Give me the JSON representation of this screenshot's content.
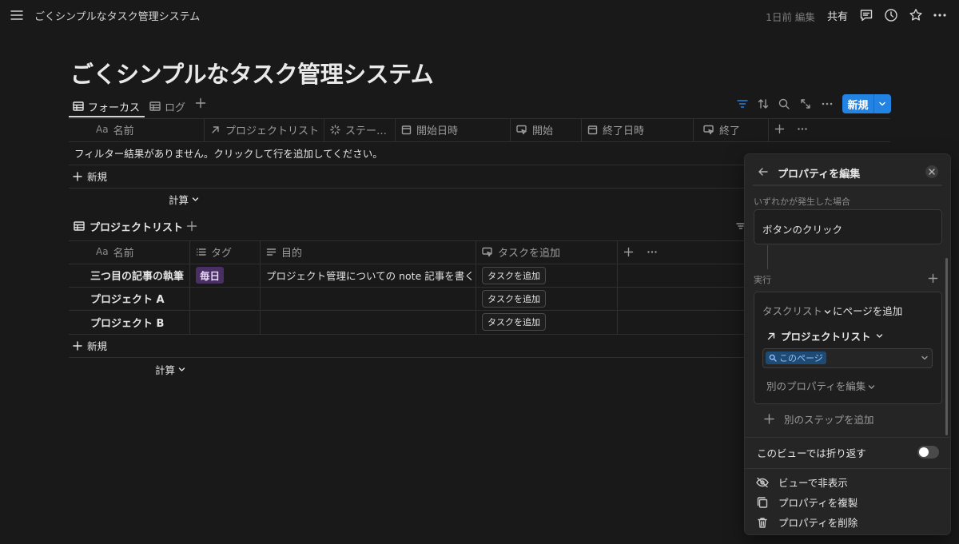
{
  "topbar": {
    "breadcrumb": "ごくシンプルなタスク管理システム",
    "edited": "1日前 編集",
    "share": "共有"
  },
  "page": {
    "title": "ごくシンプルなタスク管理システム",
    "tabs": [
      {
        "label": "フォーカス",
        "active": true
      },
      {
        "label": "ログ",
        "active": false
      }
    ],
    "new_button": "新規"
  },
  "focus_table": {
    "columns": [
      {
        "label": "名前",
        "type": "title"
      },
      {
        "label": "プロジェクトリスト",
        "type": "relation"
      },
      {
        "label": "ステー…",
        "type": "status"
      },
      {
        "label": "開始日時",
        "type": "date"
      },
      {
        "label": "開始",
        "type": "button"
      },
      {
        "label": "終了日時",
        "type": "date"
      },
      {
        "label": "終了",
        "type": "button"
      }
    ],
    "empty_text": "フィルター結果がありません。クリックして行を追加してください。",
    "add_new": "新規",
    "calc": "計算"
  },
  "project_table": {
    "title": "プロジェクトリスト",
    "columns": [
      {
        "label": "名前",
        "type": "title"
      },
      {
        "label": "タグ",
        "type": "multi_select"
      },
      {
        "label": "目的",
        "type": "text"
      },
      {
        "label": "タスクを追加",
        "type": "button"
      }
    ],
    "rows": [
      {
        "name": "三つ目の記事の執筆",
        "tag": "毎日",
        "purpose": "プロジェクト管理についての note 記事を書く",
        "button": "タスクを追加"
      },
      {
        "name": "プロジェクト A",
        "tag": "",
        "purpose": "",
        "button": "タスクを追加"
      },
      {
        "name": "プロジェクト B",
        "tag": "",
        "purpose": "",
        "button": "タスクを追加"
      }
    ],
    "add_new": "新規",
    "calc": "計算",
    "aa": "Aa",
    "tag_color": "#492f64"
  },
  "panel": {
    "title": "プロパティを編集",
    "trigger_label": "いずれかが発生した場合",
    "trigger": "ボタンのクリック",
    "exec_label": "実行",
    "action_db": "タスクリスト",
    "action_suffix": "にページを追加",
    "relation_prop": "プロジェクトリスト",
    "relation_value": "このページ",
    "edit_other": "別のプロパティを編集",
    "add_step": "別のステップを追加",
    "wrap_label": "このビューでは折り返す",
    "wrap_on": false,
    "menu": [
      {
        "label": "ビューで非表示",
        "icon": "eye-off-icon"
      },
      {
        "label": "プロパティを複製",
        "icon": "duplicate-icon"
      },
      {
        "label": "プロパティを削除",
        "icon": "trash-icon"
      }
    ]
  },
  "colors": {
    "accent": "#2383e2",
    "background": "#191919",
    "panel": "#252525"
  }
}
